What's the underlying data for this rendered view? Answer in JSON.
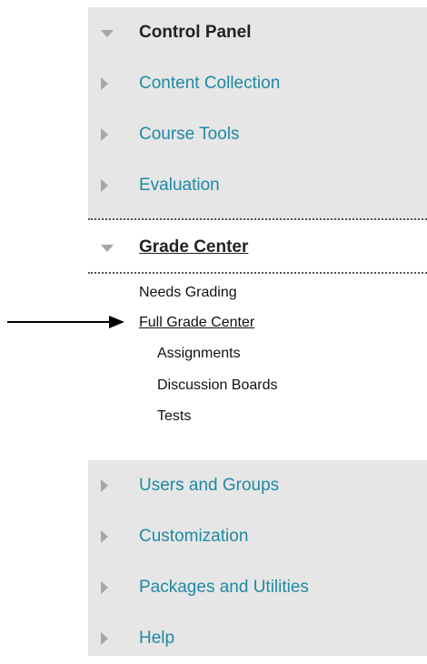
{
  "menu": {
    "header": "Control Panel",
    "items_top": [
      "Content Collection",
      "Course Tools",
      "Evaluation"
    ],
    "expanded_section": "Grade Center",
    "sub_items": [
      "Needs Grading",
      "Full Grade Center",
      "Assignments",
      "Discussion Boards",
      "Tests"
    ],
    "items_bottom": [
      "Users and Groups",
      "Customization",
      "Packages and Utilities",
      "Help"
    ]
  },
  "colors": {
    "link": "#1f8aa3",
    "panel_bg": "#e6e6e6",
    "triangle": "#a6a6a6"
  }
}
